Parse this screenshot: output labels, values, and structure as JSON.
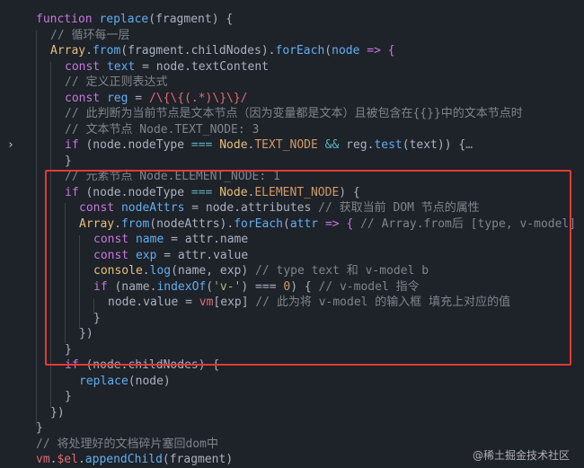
{
  "editor": {
    "lines": [
      [
        "function",
        " replace",
        "(fragment) {"
      ],
      [
        "// 循环每一层"
      ],
      [
        "Array",
        ".",
        "from",
        "(fragment.",
        "childNodes",
        ").",
        "forEach",
        "(",
        "node",
        " => {"
      ],
      [
        "const",
        " text",
        " = node.",
        "textContent"
      ],
      [
        "// 定义正则表达式"
      ],
      [
        "const",
        " reg",
        " = ",
        "/\\{\\{(.*)\\}\\}/"
      ],
      [
        "// 此判断为当前节点是文本节点（因为变量都是文本）且被包含在{{}}中的文本节点时"
      ],
      [
        "// 文本节点 Node.TEXT_NODE: 3"
      ],
      [
        "if",
        " (node.",
        "nodeType",
        " === ",
        "Node",
        ".",
        "TEXT_NODE",
        " && ",
        "reg",
        ".",
        "test",
        "(text)) {",
        "…"
      ],
      [
        "}"
      ],
      [
        "// 元素节点 Node.ELEMENT_NODE: 1"
      ],
      [
        "if",
        " (node.",
        "nodeType",
        " === ",
        "Node",
        ".",
        "ELEMENT_NODE",
        ") {"
      ],
      [
        "const",
        " nodeAttrs",
        " = node.",
        "attributes",
        " // 获取当前 DOM 节点的属性"
      ],
      [
        "Array",
        ".",
        "from",
        "(nodeAttrs).",
        "forEach",
        "(",
        "attr",
        " => { ",
        "// Array.from后 [type, v-model]"
      ],
      [
        "const",
        " name",
        " = attr.",
        "name"
      ],
      [
        "const",
        " exp",
        " = attr.",
        "value"
      ],
      [
        "console",
        ".",
        "log",
        "(name, exp) ",
        "// type text 和 v-model b"
      ],
      [
        "if",
        " (name.",
        "indexOf",
        "(",
        "'v-'",
        ") === ",
        "0",
        ") { ",
        "// v-model 指令"
      ],
      [
        "node.",
        "value",
        " = ",
        "vm",
        "[exp] ",
        "// 此为将 v-model 的输入框 填充上对应的值"
      ],
      [
        "}"
      ],
      [
        "})"
      ],
      [
        "}"
      ],
      [
        "if",
        " (node.",
        "childNodes",
        ") {"
      ],
      [
        "replace",
        "(node)"
      ],
      [
        "}"
      ],
      [
        "})"
      ],
      [
        "}"
      ],
      [
        "// 将处理好的文档碎片塞回dom中"
      ],
      [
        "vm",
        ".",
        "$el",
        ".",
        "appendChild",
        "(fragment)"
      ]
    ],
    "watermark": "@稀土掘金技术社区"
  }
}
